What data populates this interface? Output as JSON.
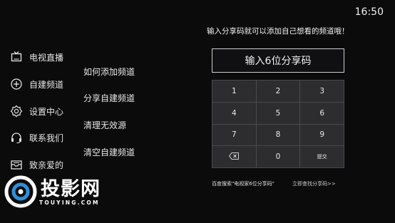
{
  "status": {
    "time": "16:50"
  },
  "sidebar": {
    "items": [
      {
        "label": "电视直播",
        "icon": "tv-icon"
      },
      {
        "label": "自建频道",
        "icon": "plus-circle-icon"
      },
      {
        "label": "设置中心",
        "icon": "gear-icon"
      },
      {
        "label": "联系我们",
        "icon": "headset-icon"
      },
      {
        "label": "致亲爱的",
        "icon": "envelope-icon"
      }
    ]
  },
  "submenu": {
    "items": [
      "如何添加频道",
      "分享自建频道",
      "清理无效源",
      "清空自建频道"
    ]
  },
  "share": {
    "hint": "输入分享码就可以添加自己想看的频道哦！",
    "input_placeholder": "输入6位分享码",
    "keys": [
      "1",
      "2",
      "3",
      "4",
      "5",
      "6",
      "7",
      "8",
      "9",
      "",
      "0",
      "提交"
    ],
    "backspace_icon": "backspace-icon",
    "search_tip": "百度搜索\"电视家6位分享码\"",
    "find_link": "立即查找分享码>>"
  },
  "watermark": {
    "brand": "投影网",
    "domain": "TOUYING.COM",
    "icon": "lens-icon"
  }
}
